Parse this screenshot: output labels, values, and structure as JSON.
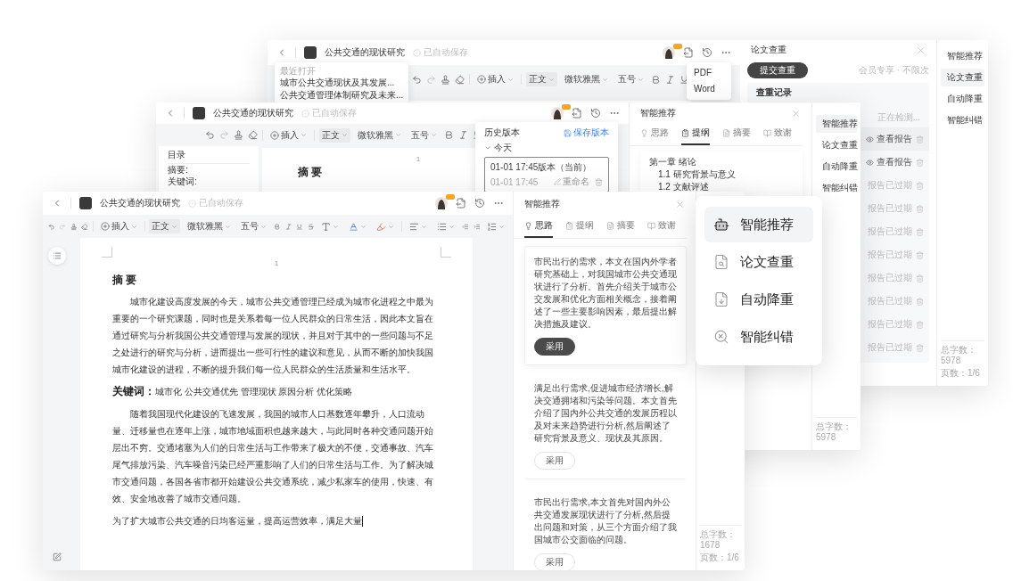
{
  "back_window": {
    "title": "公共交通的现状研究",
    "save_status": "已自动保存",
    "toolbar": {
      "insert": "插入",
      "style": "正文",
      "font": "微软雅黑",
      "size": "五号"
    },
    "recent_menu": {
      "heading": "最近打开",
      "items": [
        "城市公共交通现状及其发展...",
        "公共交通管理体制研究及未来..."
      ]
    },
    "export_menu": [
      "PDF",
      "Word"
    ],
    "check_panel": {
      "title": "论文查重",
      "submit": "提交查重",
      "member_note": "会员专享 · 不限次",
      "records_title": "查重记录",
      "status": "正在检测...",
      "records": [
        {
          "kind": "report",
          "label": "查看报告"
        },
        {
          "kind": "report",
          "label": "查看报告"
        },
        {
          "kind": "expired",
          "label": "报告已过期"
        },
        {
          "kind": "expired",
          "label": "报告已过期"
        },
        {
          "kind": "expired",
          "label": "报告已过期"
        },
        {
          "kind": "expired",
          "label": "报告已过期"
        },
        {
          "kind": "expired",
          "label": "报告已过期"
        },
        {
          "kind": "expired",
          "label": "报告已过期"
        },
        {
          "kind": "expired",
          "label": "报告已过期"
        },
        {
          "kind": "expired",
          "label": "报告已过期"
        }
      ]
    },
    "sidebar": {
      "items": [
        {
          "label": "智能推荐",
          "selected": false
        },
        {
          "label": "论文查重",
          "selected": true
        },
        {
          "label": "自动降重",
          "selected": false
        },
        {
          "label": "智能纠错",
          "selected": false
        }
      ],
      "word_count": "总字数：5978",
      "pages": "页数：1/6"
    }
  },
  "middle_window": {
    "title": "公共交通的现状研究",
    "save_status": "已自动保存",
    "toolbar": {
      "insert": "插入",
      "style": "正文",
      "font": "微软雅黑",
      "size": "五号"
    },
    "outline": {
      "title": "目录",
      "items": [
        "摘要:",
        "关键词:"
      ]
    },
    "page_number": "1",
    "heading": "摘 要",
    "history": {
      "title": "历史版本",
      "save": "保存版本",
      "group": "今天",
      "versions": [
        {
          "name": "01-01 17:45版本（当前）",
          "time": "01-01 17:45",
          "rename": "重命名",
          "selected": true
        }
      ]
    },
    "panel": {
      "title": "智能推荐",
      "tabs": [
        {
          "label": "思路",
          "selected": false
        },
        {
          "label": "提纲",
          "selected": true
        },
        {
          "label": "摘要",
          "selected": false
        },
        {
          "label": "致谢",
          "selected": false
        }
      ],
      "outline": [
        "第一章 绪论",
        "1.1 研究背景与意义",
        "1.2 文献评述"
      ]
    },
    "sidebar": {
      "items": [
        {
          "label": "智能推荐",
          "selected": true
        },
        {
          "label": "论文查重",
          "selected": false
        },
        {
          "label": "自动降重",
          "selected": false
        },
        {
          "label": "智能纠错",
          "selected": false
        }
      ],
      "word_count": "总字数：5978"
    }
  },
  "front_window": {
    "title": "公共交通的现状研究",
    "save_status": "已自动保存",
    "toolbar": {
      "insert": "插入",
      "style": "正文",
      "font": "微软雅黑",
      "size": "五号"
    },
    "page_number": "1",
    "heading": "摘 要",
    "paragraphs": [
      "城市化建设高度发展的今天，城市公共交通管理已经成为城市化进程之中最为重要的一个研究课题，同时也是关系着每一位人民群众的日常生活，因此本文旨在通过研究与分析我国公共交通管理与发展的现状，并且对于其中的一些问题与不足之处进行的研究与分析，进而提出一些可行性的建议和意见，从而不断的加快我国城市化建设的进程，不断的提升我们每一位人民群众的生活质量和生活水平。",
      "**关键词：**城市化  公共交通优先  管理现状  原因分析  优化策略",
      "随着我国现代化建设的飞速发展，我国的城市人口基数逐年攀升，人口流动量、迁移量也在逐年上涨，城市地域面积也越来越大，与此同时各种交通问题开始层出不穷。交通堵塞为人们的日常生活与工作带来了极大的不便，交通事故、汽车尾气排放污染、汽车噪音污染已经严重影响了人们的日常生活与工作。为了解决城市交通问题，各国各省市都开始建设公共交通系统，减少私家车的使用，快速、有效、安全地改善了城市交通问题。",
      "为了扩大城市公共交通的日均客运量，提高运营效率，满足大量"
    ],
    "panel": {
      "title": "智能推荐",
      "tabs": [
        {
          "label": "思路",
          "selected": true
        },
        {
          "label": "提纲",
          "selected": false
        },
        {
          "label": "摘要",
          "selected": false
        },
        {
          "label": "致谢",
          "selected": false
        }
      ],
      "cards": [
        {
          "text": "市民出行的需求，本文在国内外学者研究基础上，对我国城市公共交通现状进行了分析。首先介绍关于城市公交发展和优化方面相关概念，接着阐述了一些主要影响因素，最后提出解决措施及建议。",
          "button": "采用",
          "selected": true
        },
        {
          "text": "满足出行需求,促进城市经济增长,解决交通拥堵和污染等问题。本文首先介绍了国内外公共交通的发展历程以及对未来趋势进行分析,然后阐述了研究背景及意义、现状及其原因。",
          "button": "采用",
          "selected": false
        },
        {
          "text": "市民出行需求,本文首先对国内外公共交通发展现状进行了分析,然后提出问题和对策，从三个方面介绍了我国城市公交面临的问题。",
          "button": "采用",
          "selected": false
        }
      ]
    },
    "sidebar": {
      "word_count": "总字数：1678",
      "pages": "页数：1/6"
    }
  },
  "feature_menu": {
    "items": [
      {
        "label": "智能推荐",
        "selected": true
      },
      {
        "label": "论文查重",
        "selected": false
      },
      {
        "label": "自动降重",
        "selected": false
      },
      {
        "label": "智能纠错",
        "selected": false
      }
    ]
  }
}
